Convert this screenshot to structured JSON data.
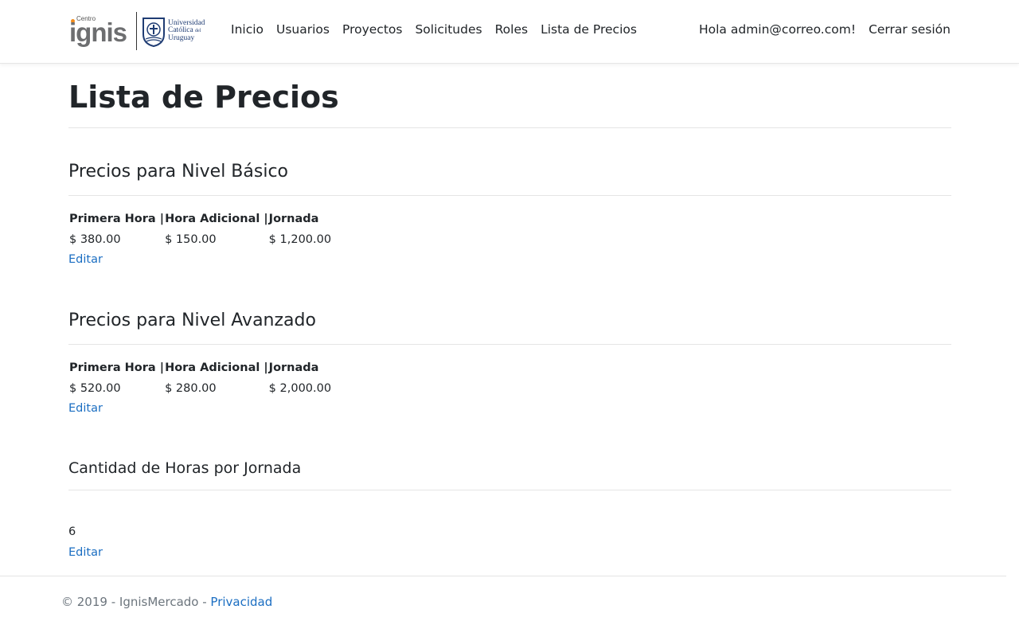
{
  "brand": {
    "ignis_small": "Centro",
    "ignis_word": "ignis",
    "ucu_line1": "Universidad",
    "ucu_line2": "Católica",
    "ucu_line2_small": "del",
    "ucu_line3": "Uruguay"
  },
  "nav": {
    "items": [
      {
        "label": "Inicio"
      },
      {
        "label": "Usuarios"
      },
      {
        "label": "Proyectos"
      },
      {
        "label": "Solicitudes"
      },
      {
        "label": "Roles"
      },
      {
        "label": "Lista de Precios"
      }
    ],
    "greeting": "Hola admin@correo.com!",
    "logout": "Cerrar sesión"
  },
  "page": {
    "title": "Lista de Precios"
  },
  "basic": {
    "heading": "Precios para Nivel Básico",
    "headers": [
      "Primera Hora |",
      "Hora Adicional |",
      "Jornada"
    ],
    "values": [
      "$ 380.00",
      "$ 150.00",
      "$ 1,200.00"
    ],
    "edit_label": "Editar"
  },
  "advanced": {
    "heading": "Precios para Nivel Avanzado",
    "headers": [
      "Primera Hora |",
      "Hora Adicional |",
      "Jornada"
    ],
    "values": [
      "$ 520.00",
      "$ 280.00",
      "$ 2,000.00"
    ],
    "edit_label": "Editar"
  },
  "hours": {
    "heading": "Cantidad de Horas por Jornada",
    "value": "6",
    "edit_label": "Editar"
  },
  "footer": {
    "text": "© 2019 - IgnisMercado - ",
    "link": "Privacidad"
  },
  "colors": {
    "link": "#1b6ec2",
    "text": "#212529",
    "brand_orange": "#f28c1b",
    "brand_gray": "#6d6e70",
    "ucu_blue": "#1f3c73"
  }
}
